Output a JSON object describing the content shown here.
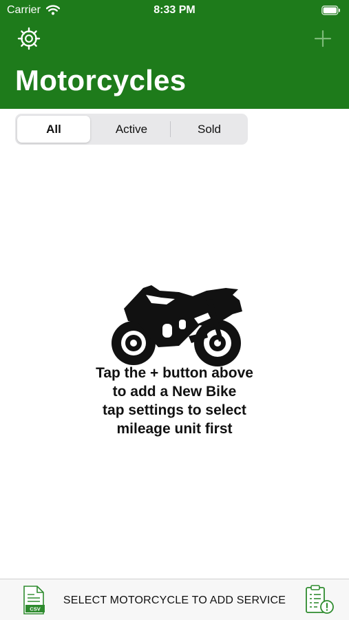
{
  "status_bar": {
    "carrier": "Carrier",
    "time": "8:33 PM"
  },
  "header": {
    "title": "Motorcycles",
    "background_color": "#1e7b1b",
    "settings_icon": "gear-icon",
    "add_icon": "plus-icon"
  },
  "filter": {
    "segments": [
      "All",
      "Active",
      "Sold"
    ],
    "selected": "All"
  },
  "empty_state": {
    "icon": "motorcycle-icon",
    "lines": [
      "Tap the + button above",
      "to add a New Bike",
      "tap settings to select",
      "mileage unit first"
    ]
  },
  "bottom_bar": {
    "left_icon": "csv-file-icon",
    "csv_icon_text": "CSV",
    "label": "SELECT MOTORCYCLE TO ADD SERVICE",
    "right_icon": "service-clipboard-icon",
    "accent_color": "#2e8b2e"
  }
}
